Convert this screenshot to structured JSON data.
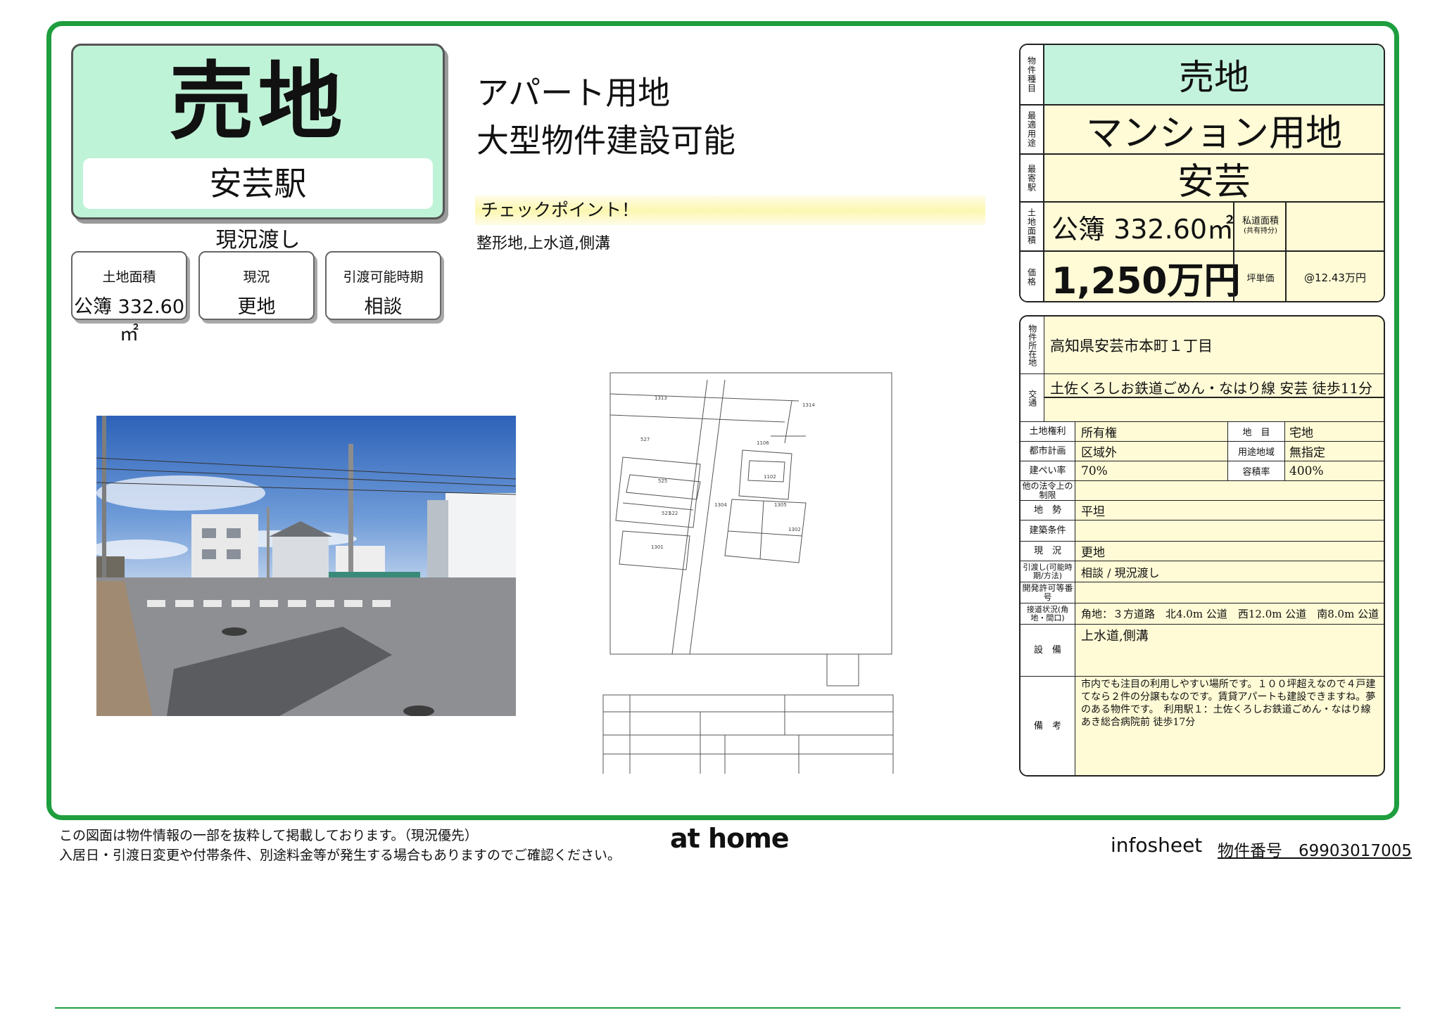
{
  "header": {
    "type": "売地",
    "station": "安芸駅",
    "condition": "現況渡し"
  },
  "info_boxes": [
    {
      "label": "土地面積",
      "value": "公簿 332.60㎡"
    },
    {
      "label": "現況",
      "value": "更地"
    },
    {
      "label": "引渡可能時期",
      "value": "相談"
    }
  ],
  "catch_lines": [
    "アパート用地",
    "大型物件建設可能"
  ],
  "checkpoint": {
    "title": "チェックポイント！",
    "text": "整形地,上水道,側溝"
  },
  "summary": {
    "type_label": "物件種目",
    "type": "売地",
    "use_label": "最適用途",
    "use": "マンション用地",
    "station_label": "最寄駅",
    "station": "安芸",
    "area_label": "土地面積",
    "area": "公簿 332.60㎡",
    "private_road_label": "私道面積",
    "private_road_sub": "(共有持分)",
    "price_label": "価格",
    "price": "1,250万円",
    "tsubo_label": "坪単価",
    "tsubo_price": "@12.43万円"
  },
  "details": {
    "address_label": "物件所在地",
    "address": "高知県安芸市本町１丁目",
    "traffic_label": "交通",
    "traffic": "土佐くろしお鉄道ごめん・なはり線 安芸 徒歩11分",
    "land_right_label": "土地権利",
    "land_right": "所有権",
    "chimoku_label": "地　目",
    "chimoku": "宅地",
    "city_plan_label": "都市計画",
    "city_plan": "区域外",
    "zoning_label": "用途地域",
    "zoning": "無指定",
    "bcr_label": "建ぺい率",
    "bcr": "70%",
    "far_label": "容積率",
    "far": "400%",
    "other_label": "他の法令上の制限",
    "other": "",
    "terrain_label": "地　勢",
    "terrain": "平坦",
    "build_cond_label": "建築条件",
    "build_cond": "",
    "status_label": "現　況",
    "status": "更地",
    "handover_label": "引渡し(可能時期/方法)",
    "handover": "相談 / 現況渡し",
    "permit_label": "開発許可等番号",
    "permit": "",
    "road_label": "接道状況(角地・間口)",
    "road": "角地：３方道路　北4.0m 公道　西12.0m 公道　南8.0m 公道",
    "facility_label": "設　備",
    "facility": "上水道,側溝",
    "remarks_label": "備　考",
    "remarks": "市内でも注目の利用しやすい場所です。１００坪超えなので４戸建てなら２件の分譲もなのです。賃貸アパートも建設できますね。夢のある物件です。　利用駅１：土佐くろしお鉄道ごめん・なはり線 あき総合病院前 徒歩17分"
  },
  "footer": {
    "note1": "この図面は物件情報の一部を抜粋して掲載しております。（現況優先）",
    "note2": "入居日・引渡日変更や付帯条件、別途料金等が発生する場合もありますのでご確認ください。",
    "logo": "at home",
    "sheet": "infosheet",
    "number": "物件番号　69903017005"
  },
  "colors": {
    "frame": "#1e9e3e",
    "title_bg": "#bff3d8",
    "table_bg": "#fffbd6"
  }
}
